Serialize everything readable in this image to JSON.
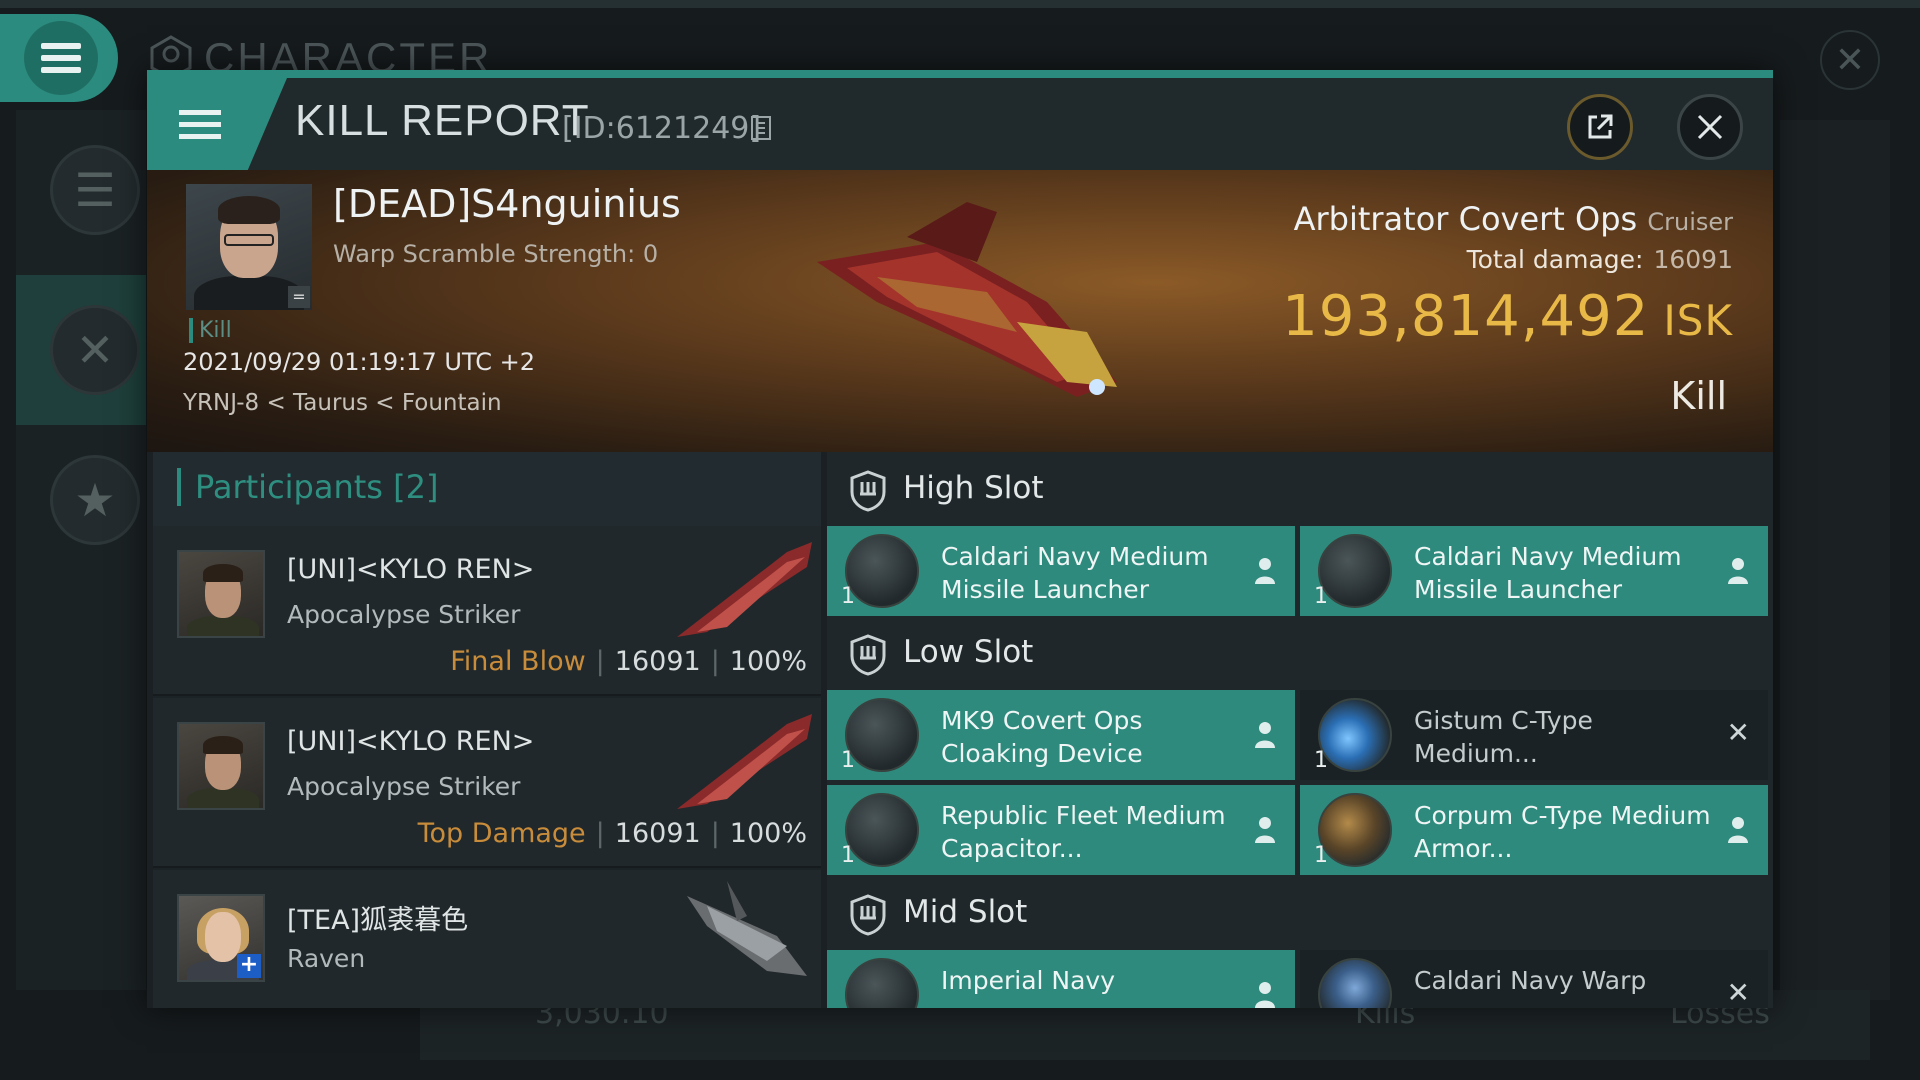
{
  "background": {
    "title": "CHARACTER",
    "bottom_value": "3,030.10",
    "bottom_kills": "Kills",
    "bottom_losses": "Losses"
  },
  "dialog": {
    "title": "KILL REPORT",
    "id": "[ID:6121249]"
  },
  "victim": {
    "name": "[DEAD]S4nguinius",
    "warp_scramble": "Warp Scramble Strength: 0",
    "kill_tag": "Kill",
    "datetime": "2021/09/29 01:19:17 UTC +2",
    "location": "YRNJ-8 < Taurus < Fountain",
    "ship": "Arbitrator Covert Ops",
    "ship_class": "Cruiser",
    "total_damage_label": "Total damage:",
    "total_damage": "16091",
    "isk_value": "193,814,492",
    "isk_unit": "ISK",
    "result": "Kill"
  },
  "participants": {
    "title": "Participants",
    "count": "[2]",
    "rows": [
      {
        "name": "[UNI]<KYLO REN>",
        "ship": "Apocalypse Striker",
        "tag": "Final Blow",
        "damage": "16091",
        "percent": "100%"
      },
      {
        "name": "[UNI]<KYLO REN>",
        "ship": "Apocalypse Striker",
        "tag": "Top Damage",
        "damage": "16091",
        "percent": "100%"
      },
      {
        "name": "[TEA]狐裘暮色",
        "ship": "Raven"
      }
    ]
  },
  "fitting": {
    "high_slot": {
      "title": "High Slot",
      "modules": [
        {
          "name": "Caldari Navy Medium Missile Launcher",
          "qty": "1",
          "status": "dropped"
        },
        {
          "name": "Caldari Navy Medium Missile Launcher",
          "qty": "1",
          "status": "dropped"
        }
      ]
    },
    "low_slot": {
      "title": "Low Slot",
      "modules": [
        {
          "name": "MK9 Covert Ops Cloaking Device",
          "qty": "1",
          "status": "dropped"
        },
        {
          "name": "Gistum C-Type Medium...",
          "qty": "1",
          "status": "destroyed"
        },
        {
          "name": "Republic Fleet Medium Capacitor...",
          "qty": "1",
          "status": "dropped"
        },
        {
          "name": "Corpum C-Type Medium Armor...",
          "qty": "1",
          "status": "dropped"
        }
      ]
    },
    "mid_slot": {
      "title": "Mid Slot",
      "modules": [
        {
          "name": "Imperial Navy",
          "status": "dropped"
        },
        {
          "name": "Caldari Navy Warp",
          "status": "destroyed"
        }
      ]
    }
  },
  "colors": {
    "accent": "#2b8b7e",
    "isk": "#e9b948",
    "tag": "#c88c3b"
  }
}
